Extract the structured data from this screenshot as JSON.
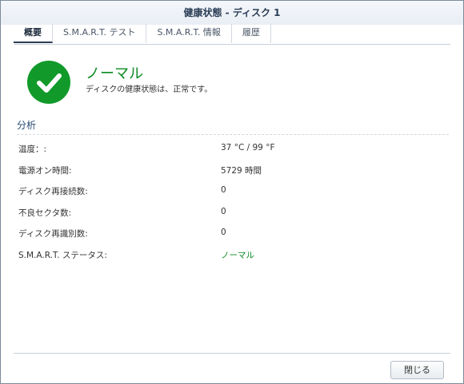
{
  "window": {
    "title": "健康状態 - ディスク 1"
  },
  "tabs": [
    {
      "label": "概要",
      "active": true
    },
    {
      "label": "S.M.A.R.T. テスト",
      "active": false
    },
    {
      "label": "S.M.A.R.T. 情報",
      "active": false
    },
    {
      "label": "履歴",
      "active": false
    }
  ],
  "status": {
    "icon": "checkmark-circle-icon",
    "title": "ノーマル",
    "description": "ディスクの健康状態は、正常です。",
    "color": "#119a2a"
  },
  "analysis": {
    "section_title": "分析",
    "rows": [
      {
        "label": "温度：:",
        "value": "37 °C / 99 °F"
      },
      {
        "label": "電源オン時間:",
        "value": "5729 時間"
      },
      {
        "label": "ディスク再接続数:",
        "value": "0"
      },
      {
        "label": "不良セクタ数:",
        "value": "0"
      },
      {
        "label": "ディスク再識別数:",
        "value": "0"
      },
      {
        "label": "S.M.A.R.T. ステータス:",
        "value": "ノーマル"
      }
    ]
  },
  "footer": {
    "close_label": "閉じる"
  }
}
